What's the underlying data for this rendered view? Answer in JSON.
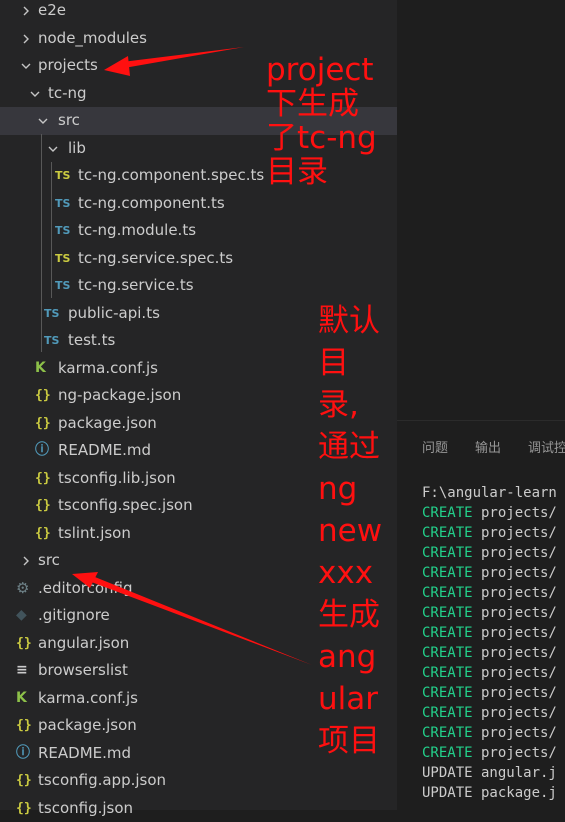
{
  "explorer": {
    "items": [
      {
        "label": "e2e",
        "type": "folder",
        "expanded": false,
        "depth": 0
      },
      {
        "label": "node_modules",
        "type": "folder",
        "expanded": false,
        "depth": 0
      },
      {
        "label": "projects",
        "type": "folder",
        "expanded": true,
        "depth": 0
      },
      {
        "label": "tc-ng",
        "type": "folder",
        "expanded": true,
        "depth": 1
      },
      {
        "label": "src",
        "type": "folder",
        "expanded": true,
        "depth": 2,
        "selected": true
      },
      {
        "label": "lib",
        "type": "folder",
        "expanded": true,
        "depth": 3
      },
      {
        "label": "tc-ng.component.spec.ts",
        "type": "spec",
        "depth": 4
      },
      {
        "label": "tc-ng.component.ts",
        "type": "ts",
        "depth": 4
      },
      {
        "label": "tc-ng.module.ts",
        "type": "ts",
        "depth": 4
      },
      {
        "label": "tc-ng.service.spec.ts",
        "type": "spec",
        "depth": 4
      },
      {
        "label": "tc-ng.service.ts",
        "type": "ts",
        "depth": 4
      },
      {
        "label": "public-api.ts",
        "type": "ts",
        "depth": 3
      },
      {
        "label": "test.ts",
        "type": "ts",
        "depth": 3
      },
      {
        "label": "karma.conf.js",
        "type": "karma",
        "depth": 2
      },
      {
        "label": "ng-package.json",
        "type": "json",
        "depth": 2
      },
      {
        "label": "package.json",
        "type": "json",
        "depth": 2
      },
      {
        "label": "README.md",
        "type": "info",
        "depth": 2
      },
      {
        "label": "tsconfig.lib.json",
        "type": "json",
        "depth": 2
      },
      {
        "label": "tsconfig.spec.json",
        "type": "json",
        "depth": 2
      },
      {
        "label": "tslint.json",
        "type": "json",
        "depth": 2
      },
      {
        "label": "src",
        "type": "folder",
        "expanded": false,
        "depth": 0
      },
      {
        "label": ".editorconfig",
        "type": "gear",
        "depth": 0
      },
      {
        "label": ".gitignore",
        "type": "git",
        "depth": 0
      },
      {
        "label": "angular.json",
        "type": "json",
        "depth": 0
      },
      {
        "label": "browserslist",
        "type": "list",
        "depth": 0
      },
      {
        "label": "karma.conf.js",
        "type": "karma",
        "depth": 0
      },
      {
        "label": "package.json",
        "type": "json",
        "depth": 0
      },
      {
        "label": "README.md",
        "type": "info",
        "depth": 0
      },
      {
        "label": "tsconfig.app.json",
        "type": "json",
        "depth": 0
      },
      {
        "label": "tsconfig.json",
        "type": "json",
        "depth": 0
      }
    ],
    "icons": {
      "ts": "TS",
      "spec": "TS",
      "json": "{}",
      "karma": "K",
      "info": "ⓘ",
      "gear": "⚙",
      "git": "◆",
      "list": "≡"
    }
  },
  "panel": {
    "tabs": [
      "问题",
      "输出",
      "调试控"
    ],
    "terminal": {
      "path_line": "F:\\angular-learn",
      "lines": [
        {
          "kw": "CREATE",
          "text": "projects/"
        },
        {
          "kw": "CREATE",
          "text": "projects/"
        },
        {
          "kw": "CREATE",
          "text": "projects/"
        },
        {
          "kw": "CREATE",
          "text": "projects/"
        },
        {
          "kw": "CREATE",
          "text": "projects/"
        },
        {
          "kw": "CREATE",
          "text": "projects/"
        },
        {
          "kw": "CREATE",
          "text": "projects/"
        },
        {
          "kw": "CREATE",
          "text": "projects/"
        },
        {
          "kw": "CREATE",
          "text": "projects/"
        },
        {
          "kw": "CREATE",
          "text": "projects/"
        },
        {
          "kw": "CREATE",
          "text": "projects/"
        },
        {
          "kw": "CREATE",
          "text": "projects/"
        },
        {
          "kw": "CREATE",
          "text": "projects/"
        },
        {
          "kw": "UPDATE",
          "text": "angular.j"
        },
        {
          "kw": "UPDATE",
          "text": "package.j"
        }
      ]
    }
  },
  "annotations": {
    "top": [
      "project",
      "下生成",
      "了tc-ng",
      "目录"
    ],
    "bottom": [
      "默认",
      "目",
      "录,",
      "通过",
      "ng",
      "new",
      "xxx",
      "生成",
      "ang",
      "ular",
      "项目"
    ]
  },
  "colors": {
    "annotation": "#ff1010",
    "create_keyword": "#23d18b",
    "ts_icon": "#519aba",
    "json_icon": "#cbcb41"
  }
}
